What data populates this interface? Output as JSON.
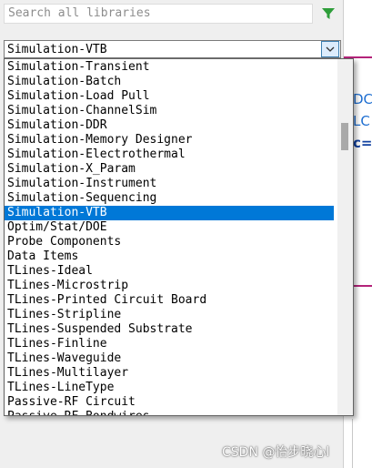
{
  "search": {
    "placeholder": "Search all libraries"
  },
  "combo": {
    "value": "Simulation-VTB"
  },
  "dropdown": {
    "items": [
      "Simulation-Transient",
      "Simulation-Batch",
      "Simulation-Load Pull",
      "Simulation-ChannelSim",
      "Simulation-DDR",
      "Simulation-Memory Designer",
      "Simulation-Electrothermal",
      "Simulation-X_Param",
      "Simulation-Instrument",
      "Simulation-Sequencing",
      "Simulation-VTB",
      "Optim/Stat/DOE",
      "Probe Components",
      "Data Items",
      "TLines-Ideal",
      "TLines-Microstrip",
      "TLines-Printed Circuit Board",
      "TLines-Stripline",
      "TLines-Suspended Substrate",
      "TLines-Finline",
      "TLines-Waveguide",
      "TLines-Multilayer",
      "TLines-LineType",
      "Passive-RF Circuit",
      "Passive-RF Bondwires"
    ],
    "selected_index": 10
  },
  "right_panel": {
    "text_1": "DC",
    "text_2": "LC",
    "text_3": "c="
  },
  "watermark": "CSDN @怡步晓心l",
  "colors": {
    "selection": "#0078d7",
    "filter_icon": "#2e9e3a",
    "right_panel_text": "#1f6fd1",
    "right_panel_line": "#b4237a"
  }
}
